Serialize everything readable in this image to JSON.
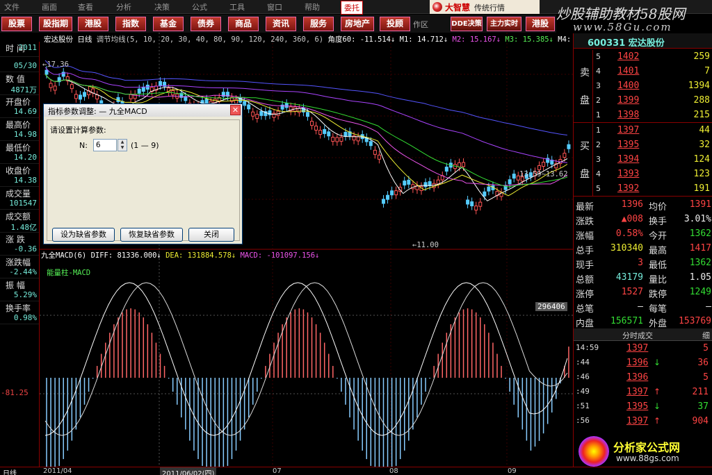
{
  "menubar": {
    "items": [
      "文件",
      "画面",
      "查看",
      "分析",
      "决策",
      "公式",
      "工具",
      "窗口",
      "帮助"
    ],
    "wt_flag": "委托",
    "brand": "大智慧",
    "brand_sub": "传统行情"
  },
  "watermark": {
    "line1": "炒股辅助教材58股网",
    "line2": "www.58Gu.com"
  },
  "toolbar": {
    "buttons": [
      "股票",
      "股指期",
      "港股",
      "指数",
      "基金",
      "债券",
      "商品",
      "资讯",
      "服务",
      "房地产",
      "投顾",
      "DDE决策",
      "主力实时",
      "港股"
    ],
    "workspace_label": "作区"
  },
  "left_panel": [
    {
      "label": "时 间",
      "value": "2011"
    },
    {
      "label": "",
      "value": "05/30"
    },
    {
      "label": "数 值",
      "value": "4871万"
    },
    {
      "label": "开盘价",
      "value": "14.69"
    },
    {
      "label": "最高价",
      "value": "14.98"
    },
    {
      "label": "最低价",
      "value": "14.20"
    },
    {
      "label": "收盘价",
      "value": "14.38"
    },
    {
      "label": "成交量",
      "value": "101547"
    },
    {
      "label": "成交额",
      "value": "1.48亿"
    },
    {
      "label": "涨 跌",
      "value": "-0.36"
    },
    {
      "label": "涨跌幅",
      "value": "-2.44%"
    },
    {
      "label": "振 幅",
      "value": "5.29%"
    },
    {
      "label": "换手率",
      "value": "0.98%"
    }
  ],
  "chart": {
    "ma_line": {
      "stock": "宏达股份",
      "period": "日线",
      "indicator": "调节均线(5, 10, 20, 30, 40, 80, 90, 120, 240, 360, 6)",
      "angle": "角度60: -11.514↓",
      "m1": "M1: 14.712↓",
      "m2": "M2: 15.167↓",
      "m3": "M3: 15.385↓",
      "m4": "M4: 16."
    },
    "high_marker": "17.36",
    "low_marker": "11.00",
    "right_marker": "13.59~13.62",
    "macd_line": {
      "name": "九全MACD(6)",
      "diff": "DIFF: 81336.000↓",
      "dea": "DEA: 131884.578↓",
      "macd": "MACD: -101097.156↓"
    },
    "macd_sub": "能量柱-MACD",
    "macd_tag": "296406",
    "y_label": "-81.25"
  },
  "chart_data": {
    "type": "line",
    "title": "宏达股份 日线",
    "annotations": [
      "17.36",
      "11.00",
      "13.59~13.62"
    ],
    "series": [
      {
        "name": "DIFF",
        "values": [
          81336
        ]
      },
      {
        "name": "DEA",
        "values": [
          131884.578
        ]
      },
      {
        "name": "MACD",
        "values": [
          -101097.156
        ]
      }
    ]
  },
  "dialog": {
    "title": "指标参数调整: — 九全MACD",
    "prompt": "请设置计算参数:",
    "n_label": "N:",
    "n_value": "6",
    "range": "(1 — 9)",
    "btn_default": "设为缺省参数",
    "btn_restore": "恢复缺省参数",
    "btn_close": "关闭"
  },
  "right_panel": {
    "stock": "600331 宏达股份",
    "sell_label": [
      "卖",
      "盘"
    ],
    "buy_label": [
      "买",
      "盘"
    ],
    "sell": [
      {
        "idx": "5",
        "price": "1402",
        "vol": "259"
      },
      {
        "idx": "4",
        "price": "1401",
        "vol": "7"
      },
      {
        "idx": "3",
        "price": "1400",
        "vol": "1394"
      },
      {
        "idx": "2",
        "price": "1399",
        "vol": "288"
      },
      {
        "idx": "1",
        "price": "1398",
        "vol": "215"
      }
    ],
    "buy": [
      {
        "idx": "1",
        "price": "1397",
        "vol": "44"
      },
      {
        "idx": "2",
        "price": "1395",
        "vol": "32"
      },
      {
        "idx": "3",
        "price": "1394",
        "vol": "124"
      },
      {
        "idx": "4",
        "price": "1393",
        "vol": "123"
      },
      {
        "idx": "5",
        "price": "1392",
        "vol": "191"
      }
    ],
    "stats": [
      {
        "l": "最新",
        "v": "1396",
        "vc": "red",
        "l2": "均价",
        "v2": "1391",
        "v2c": "red"
      },
      {
        "l": "涨跌",
        "v": "▲008",
        "vc": "red",
        "l2": "换手",
        "v2": "3.01%",
        "v2c": "wht"
      },
      {
        "l": "涨幅",
        "v": "0.58%",
        "vc": "red",
        "l2": "今开",
        "v2": "1362",
        "v2c": "grn"
      },
      {
        "l": "总手",
        "v": "310340",
        "vc": "yel",
        "l2": "最高",
        "v2": "1417",
        "v2c": "red"
      },
      {
        "l": "现手",
        "v": "3",
        "vc": "red",
        "l2": "最低",
        "v2": "1362",
        "v2c": "grn"
      },
      {
        "l": "总额",
        "v": "43179",
        "vc": "cyan",
        "l2": "量比",
        "v2": "1.05",
        "v2c": "wht"
      },
      {
        "l": "涨停",
        "v": "1527",
        "vc": "red",
        "l2": "跌停",
        "v2": "1249",
        "v2c": "grn"
      },
      {
        "l": "总笔",
        "v": "—",
        "vc": "wht",
        "l2": "每笔",
        "v2": "—",
        "v2c": "wht"
      },
      {
        "l": "内盘",
        "v": "156571",
        "vc": "grn",
        "l2": "外盘",
        "v2": "153769",
        "v2c": "red"
      }
    ],
    "tick_header": {
      "title": "分时成交",
      "right": "细"
    },
    "ticks": [
      {
        "time": "14:59",
        "price": "1397",
        "dir": "",
        "vol": "5",
        "vc": "red"
      },
      {
        "time": ":44",
        "price": "1396",
        "dir": "↓",
        "vol": "36",
        "vc": "red"
      },
      {
        "time": ":46",
        "price": "1396",
        "dir": "",
        "vol": "5",
        "vc": "red"
      },
      {
        "time": ":49",
        "price": "1397",
        "dir": "↑",
        "vol": "211",
        "vc": "red"
      },
      {
        "time": ":51",
        "price": "1395",
        "dir": "↓",
        "vol": "37",
        "vc": "grn"
      },
      {
        "time": ":56",
        "price": "1397",
        "dir": "↑",
        "vol": "904",
        "vc": "red"
      }
    ]
  },
  "logo2": {
    "line1": "分析家公式网",
    "line2": "www.88gs.com"
  },
  "status": {
    "left": "日线",
    "date1": "2011/04",
    "date2": "2011/06/02(四)",
    "m7": "07",
    "m8": "08",
    "m9": "09"
  },
  "colors": {
    "up": "#ff4444",
    "down": "#55ccff",
    "brand_red": "#c0392b"
  }
}
